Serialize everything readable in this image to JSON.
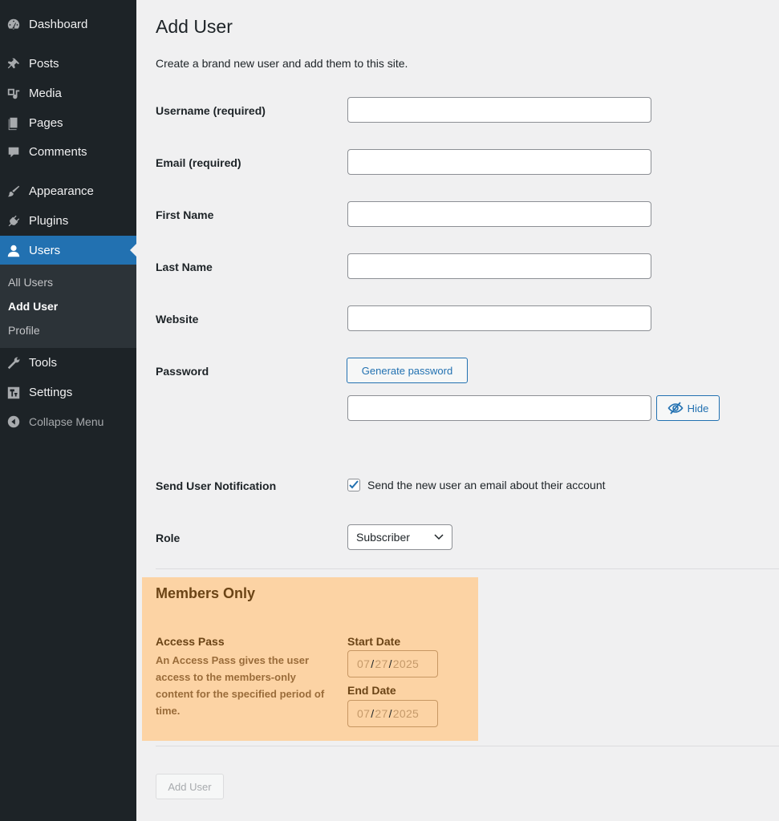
{
  "sidebar": {
    "menu": [
      {
        "id": "dashboard",
        "label": "Dashboard",
        "icon": "dashboard-icon"
      },
      {
        "id": "posts",
        "label": "Posts",
        "icon": "pin-icon"
      },
      {
        "id": "media",
        "label": "Media",
        "icon": "media-icon"
      },
      {
        "id": "pages",
        "label": "Pages",
        "icon": "pages-icon"
      },
      {
        "id": "comments",
        "label": "Comments",
        "icon": "comment-icon"
      },
      {
        "id": "appearance",
        "label": "Appearance",
        "icon": "brush-icon"
      },
      {
        "id": "plugins",
        "label": "Plugins",
        "icon": "plugin-icon"
      },
      {
        "id": "users",
        "label": "Users",
        "icon": "user-icon"
      },
      {
        "id": "tools",
        "label": "Tools",
        "icon": "wrench-icon"
      },
      {
        "id": "settings",
        "label": "Settings",
        "icon": "settings-icon"
      }
    ],
    "submenu": [
      "All Users",
      "Add User",
      "Profile"
    ],
    "collapse_label": "Collapse Menu",
    "active_color": "#2271b1",
    "bg_color": "#1d2327"
  },
  "page": {
    "title": "Add User",
    "intro": "Create a brand new user and add them to this site."
  },
  "form": {
    "username_label": "Username (required)",
    "email_label": "Email (required)",
    "first_name_label": "First Name",
    "last_name_label": "Last Name",
    "website_label": "Website",
    "password_label": "Password",
    "generate_password_label": "Generate password",
    "hide_label": "Hide",
    "notification_label": "Send User Notification",
    "notification_text": "Send the new user an email about their account",
    "notification_checked": true,
    "role_label": "Role",
    "role_value": "Subscriber"
  },
  "members": {
    "title": "Members Only",
    "access_label": "Access Pass",
    "access_desc": "An Access Pass gives the user access to the members-only content for the specified period of time.",
    "start_label": "Start Date",
    "end_label": "End Date",
    "start_date": {
      "mm": "07",
      "dd": "27",
      "yyyy": "2025"
    },
    "end_date": {
      "mm": "07",
      "dd": "27",
      "yyyy": "2025"
    },
    "highlight_color": "#fcd3a4"
  },
  "submit_label": "Add User"
}
